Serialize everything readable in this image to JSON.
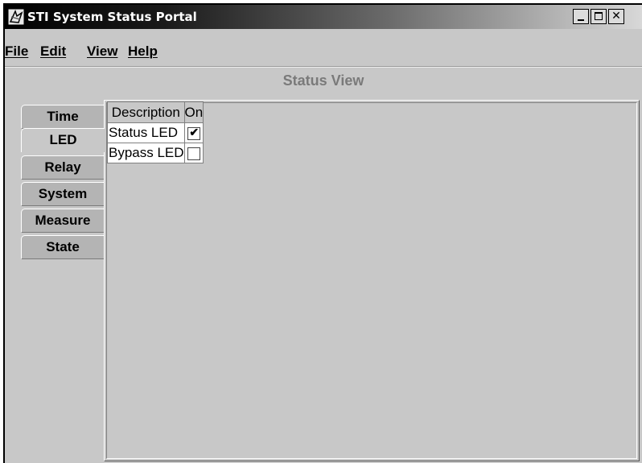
{
  "window": {
    "title": "STI System Status Portal",
    "min_label": "_",
    "close_label": "✕"
  },
  "menu": {
    "file": "File",
    "edit": "Edit",
    "view": "View",
    "help": "Help"
  },
  "main": {
    "title": "Status View"
  },
  "tabs": [
    {
      "label": "Time"
    },
    {
      "label": "LED"
    },
    {
      "label": "Relay"
    },
    {
      "label": "System"
    },
    {
      "label": "Measure"
    },
    {
      "label": "State"
    }
  ],
  "selected_tab": "LED",
  "table": {
    "headers": [
      "Description",
      "On"
    ],
    "rows": [
      {
        "description": "Status LED",
        "on": true,
        "mark": "✔"
      },
      {
        "description": "Bypass LED",
        "on": false,
        "mark": ""
      }
    ]
  }
}
